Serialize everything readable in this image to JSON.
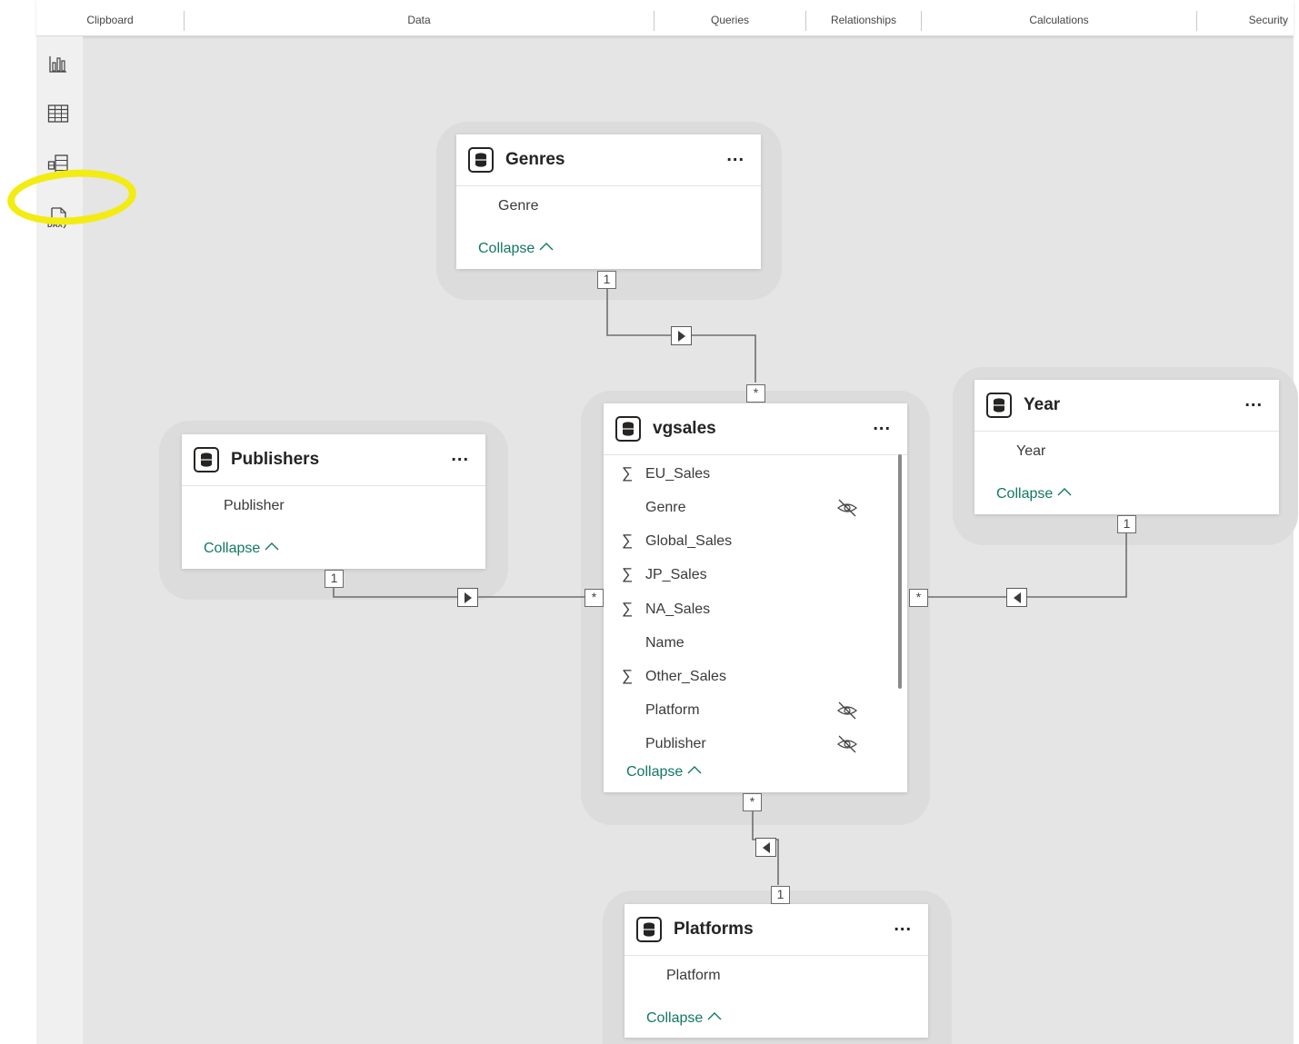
{
  "ribbon": {
    "groups": [
      "Clipboard",
      "Data",
      "Queries",
      "Relationships",
      "Calculations",
      "Security"
    ]
  },
  "nav": {
    "items": [
      {
        "icon": "report-view-icon"
      },
      {
        "icon": "table-view-icon"
      },
      {
        "icon": "model-view-icon",
        "highlighted": true
      },
      {
        "icon": "dax-query-view-icon"
      }
    ],
    "highlight_color": "#f2ec12"
  },
  "tables": {
    "genres": {
      "name": "Genres",
      "menu": "...",
      "fields": [
        "Genre"
      ],
      "collapse": "Collapse"
    },
    "vgsales": {
      "name": "vgsales",
      "menu": "...",
      "fields": [
        {
          "name": "EU_Sales",
          "aggregate": "∑",
          "hidden": false
        },
        {
          "name": "Genre",
          "aggregate": "",
          "hidden": true
        },
        {
          "name": "Global_Sales",
          "aggregate": "∑",
          "hidden": false
        },
        {
          "name": "JP_Sales",
          "aggregate": "∑",
          "hidden": false
        },
        {
          "name": "NA_Sales",
          "aggregate": "∑",
          "hidden": false
        },
        {
          "name": "Name",
          "aggregate": "",
          "hidden": false
        },
        {
          "name": "Other_Sales",
          "aggregate": "∑",
          "hidden": false
        },
        {
          "name": "Platform",
          "aggregate": "",
          "hidden": true
        },
        {
          "name": "Publisher",
          "aggregate": "",
          "hidden": true
        }
      ],
      "collapse": "Collapse"
    },
    "publishers": {
      "name": "Publishers",
      "menu": "...",
      "fields": [
        "Publisher"
      ],
      "collapse": "Collapse"
    },
    "year": {
      "name": "Year",
      "menu": "...",
      "fields": [
        "Year"
      ],
      "collapse": "Collapse"
    },
    "platforms": {
      "name": "Platforms",
      "menu": "...",
      "fields": [
        "Platform"
      ],
      "collapse": "Collapse"
    }
  },
  "relationships": [
    {
      "from": "Genres",
      "to": "vgsales",
      "one": "1",
      "many": "*",
      "direction": "right"
    },
    {
      "from": "Publishers",
      "to": "vgsales",
      "one": "1",
      "many": "*",
      "direction": "right"
    },
    {
      "from": "Year",
      "to": "vgsales",
      "one": "1",
      "many": "*",
      "direction": "left"
    },
    {
      "from": "Platforms",
      "to": "vgsales",
      "one": "1",
      "many": "*",
      "direction": "left"
    }
  ],
  "colors": {
    "accent": "#117865",
    "canvas": "#e5e5e5"
  }
}
